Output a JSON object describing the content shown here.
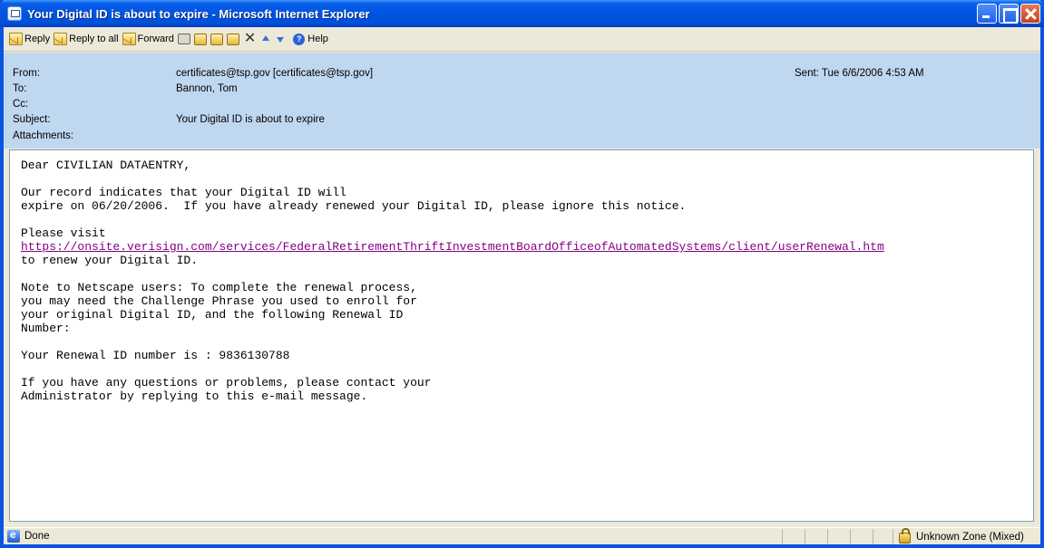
{
  "window": {
    "title": "Your Digital ID is about to expire - Microsoft Internet Explorer"
  },
  "toolbar": {
    "reply_label": "Reply",
    "reply_all_label": "Reply to all",
    "forward_label": "Forward",
    "help_label": "Help"
  },
  "header": {
    "from_label": "From:",
    "from_value": "certificates@tsp.gov [certificates@tsp.gov]",
    "to_label": "To:",
    "to_value": "Bannon, Tom",
    "cc_label": "Cc:",
    "cc_value": "",
    "subject_label": "Subject:",
    "subject_value": "Your Digital ID is about to expire",
    "attachments_label": "Attachments:",
    "sent_label": "Sent:",
    "sent_value": "Tue 6/6/2006 4:53 AM"
  },
  "message": {
    "greeting": "Dear CIVILIAN DATAENTRY,",
    "para1_line1": "Our record indicates that your Digital ID will",
    "para1_line2": "expire on 06/20/2006.  If you have already renewed your Digital ID, please ignore this notice.",
    "visit_label": "Please visit",
    "renewal_link": "https://onsite.verisign.com/services/FederalRetirementThriftInvestmentBoardOfficeofAutomatedSystems/client/userRenewal.htm",
    "visit_after": "to renew your Digital ID.",
    "note_line1": "Note to Netscape users: To complete the renewal process,",
    "note_line2": "you may need the Challenge Phrase you used to enroll for",
    "note_line3": "your original Digital ID, and the following Renewal ID",
    "note_line4": "Number:",
    "renewal_id": "Your Renewal ID number is : 9836130788",
    "contact_line1": "If you have any questions or problems, please contact your",
    "contact_line2": "Administrator by replying to this e-mail message."
  },
  "status": {
    "text": "Done",
    "zone": "Unknown Zone (Mixed)"
  },
  "colors": {
    "titlebar": "#0054e3",
    "header_bg": "#c0d7f0",
    "link": "#800080"
  }
}
